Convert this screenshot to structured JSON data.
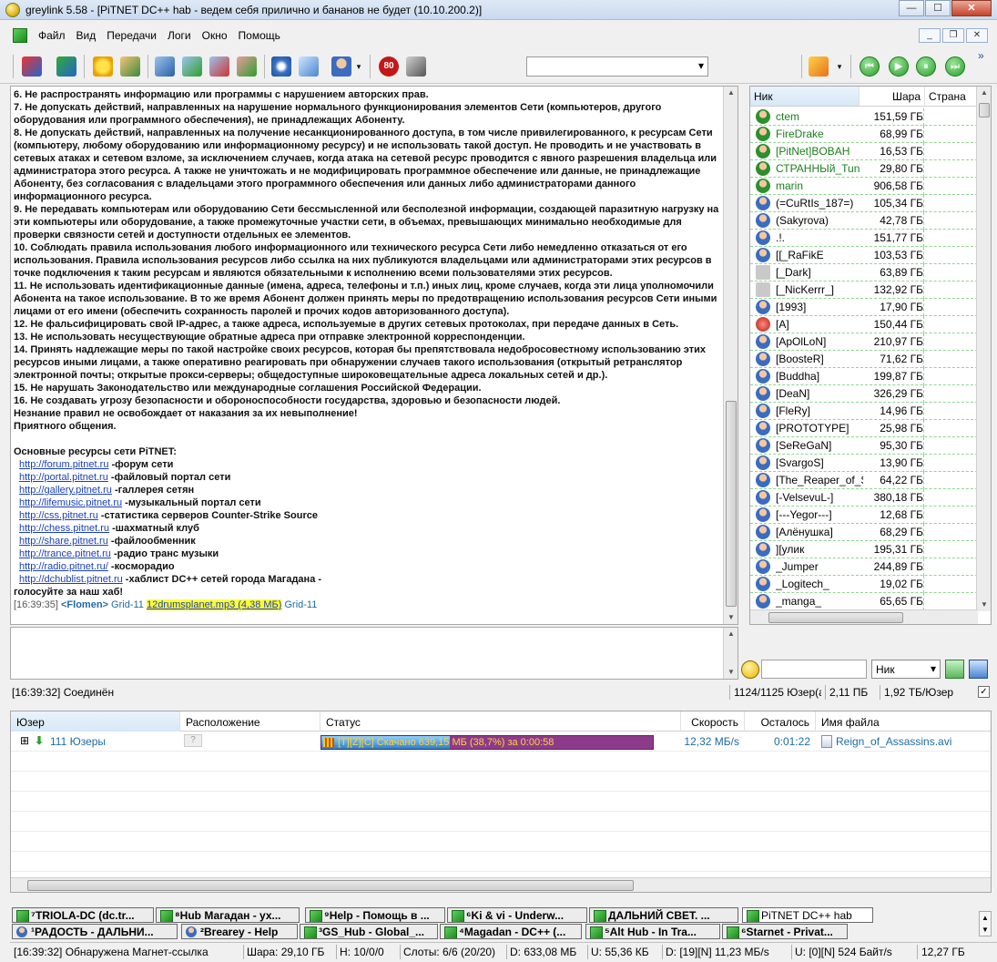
{
  "window": {
    "title": "greylink 5.58 - [PiTNET DC++ hab - ведем себя прилично и бананов не будет (10.10.200.2)]",
    "btn_min": "—",
    "btn_max": "☐",
    "btn_close": "✕"
  },
  "menu": {
    "items": [
      "Файл",
      "Вид",
      "Передачи",
      "Логи",
      "Окно",
      "Помощь"
    ]
  },
  "toolbar": {
    "speed_limit_label": "80",
    "more": "»"
  },
  "chat": {
    "lines": [
      "6. Не распространять информацию или программы с нарушением авторских прав.",
      "7. Не допускать действий, направленных на нарушение нормального функционирования элементов Сети (компьютеров, другого оборудования или программного обеспечения), не принадлежащих Абоненту.",
      "8. Не допускать действий, направленных на получение несанкционированного доступа, в том числе привилегированного, к ресурсам Сети (компьютеру, любому оборудованию или информационному ресурсу) и не использовать такой доступ. Не проводить и не участвовать в сетевых атаках и сетевом взломе, за исключением случаев, когда атака на сетевой ресурс проводится с явного разрешения владельца или администратора этого ресурса. А также не уничтожать и не модифицировать программное обеспечение или данные, не принадлежащие Абоненту, без согласования с владельцами этого программного обеспечения или данных либо администраторами данного информационного ресурса.",
      "9. Не передавать компьютерам или оборудованию Сети бессмысленной или бесполезной информации, создающей паразитную нагрузку на эти компьютеры или оборудование, а также промежуточные участки сети, в объемах, превышающих минимально необходимые для проверки связности сетей и доступности отдельных ее элементов.",
      "10. Соблюдать правила использования любого информационного или технического ресурса Сети либо немедленно отказаться от его использования. Правила использования ресурсов либо ссылка на них публикуются владельцами или администраторами этих ресурсов в точке подключения к таким ресурсам и являются обязательными к исполнению всеми пользователями этих ресурсов.",
      "11. Не использовать идентификационные данные (имена, адреса, телефоны и т.п.) иных лиц, кроме случаев, когда эти лица уполномочили Абонента на такое использование. В то же время Абонент должен принять меры по предотвращению использования ресурсов Сети иными лицами от его имени (обеспечить сохранность паролей и прочих кодов авторизованного доступа).",
      "12. Не фальсифицировать свой IP-адрес, а также адреса, используемые в других сетевых протоколах, при передаче данных в Сеть.",
      "13. Не использовать несуществующие обратные адреса при отправке электронной корреспонденции.",
      "14. Принять надлежащие меры по такой настройке своих ресурсов, которая бы препятствовала недобросовестному использованию этих ресурсов иными лицами, а также оперативно реагировать при обнаружении случаев такого использования (открытый ретранслятор электронной почты; открытые прокси-серверы; общедоступные широковещательные адреса локальных сетей и др.).",
      "15. Не нарушать Законодательство или международные соглашения Российской Федерации.",
      "16. Не создавать угрозу безопасности и обороноспособности государства, здоровью и безопасности людей.",
      "Незнание правил не освобождает от наказания за их невыполнение!",
      "Приятного общения.",
      "",
      "Основные ресурсы сети PiTNET:"
    ],
    "resources": [
      {
        "url": "http://forum.pitnet.ru",
        "desc": "-форум сети"
      },
      {
        "url": "http://portal.pitnet.ru",
        "desc": "-файловый портал сети"
      },
      {
        "url": "http://gallery.pitnet.ru",
        "desc": "-галлерея сетян"
      },
      {
        "url": "http://lifemusic.pitnet.ru",
        "desc": "-музыкальный портал сети"
      },
      {
        "url": "http://css.pitnet.ru",
        "desc": "-статистика серверов Counter-Strike Source"
      },
      {
        "url": "http://chess.pitnet.ru",
        "desc": "-шахматный клуб"
      },
      {
        "url": "http://share.pitnet.ru",
        "desc": "-файлообменник"
      },
      {
        "url": "http://trance.pitnet.ru",
        "desc": "-радио транс музыки"
      },
      {
        "url": "http://radio.pitnet.ru/",
        "desc": "-косморадио"
      },
      {
        "url": "http://dchublist.pitnet.ru",
        "desc": "-хаблист DC++ сетей города Магадана -"
      }
    ],
    "closing": "голосуйте за наш хаб!",
    "message": {
      "time": "[16:39:35]",
      "nick": "<Flomen>",
      "prefix": "Grid-11",
      "file": "12drumsplanet.mp3 (4,38 МБ)",
      "suffix": "Grid-11"
    }
  },
  "userlist": {
    "headers": {
      "nick": "Ник",
      "share": "Шара",
      "country": "Страна"
    },
    "users": [
      {
        "nick": "ctem",
        "share": "151,59 ГБ",
        "kind": "op"
      },
      {
        "nick": "FireDrake",
        "share": "68,99 ГБ",
        "kind": "op"
      },
      {
        "nick": "[PitNet]BOBAH",
        "share": "16,53 ГБ",
        "kind": "op"
      },
      {
        "nick": "СТРАННЫй_Tun",
        "share": "29,80 ГБ",
        "kind": "op"
      },
      {
        "nick": "marin",
        "share": "906,58 ГБ",
        "kind": "op"
      },
      {
        "nick": "(=CuRtIs_187=)",
        "share": "105,34 ГБ",
        "kind": "user"
      },
      {
        "nick": "(Sakyrova)",
        "share": "42,78 ГБ",
        "kind": "user"
      },
      {
        "nick": ".!.",
        "share": "151,77 ГБ",
        "kind": "user"
      },
      {
        "nick": "[[_RaFikE",
        "share": "103,53 ГБ",
        "kind": "user"
      },
      {
        "nick": "[_Dark]",
        "share": "63,89 ГБ",
        "kind": "gray"
      },
      {
        "nick": "[_NicKerrr_]",
        "share": "132,92 ГБ",
        "kind": "gray"
      },
      {
        "nick": "[1993]",
        "share": "17,90 ГБ",
        "kind": "user"
      },
      {
        "nick": "[A]",
        "share": "150,44 ГБ",
        "kind": "red"
      },
      {
        "nick": "[ApOlLoN]",
        "share": "210,97 ГБ",
        "kind": "user"
      },
      {
        "nick": "[BoosteR]",
        "share": "71,62 ГБ",
        "kind": "user"
      },
      {
        "nick": "[Buddha]",
        "share": "199,87 ГБ",
        "kind": "user"
      },
      {
        "nick": "[DeaN]",
        "share": "326,29 ГБ",
        "kind": "user"
      },
      {
        "nick": "[FleRy]",
        "share": "14,96 ГБ",
        "kind": "user"
      },
      {
        "nick": "[PROTOTYPE]",
        "share": "25,98 ГБ",
        "kind": "user"
      },
      {
        "nick": "[SeReGaN]",
        "share": "95,30 ГБ",
        "kind": "user"
      },
      {
        "nick": "[SvargoS]",
        "share": "13,90 ГБ",
        "kind": "user"
      },
      {
        "nick": "[The_Reaper_of_S",
        "share": "64,22 ГБ",
        "kind": "user"
      },
      {
        "nick": "[-VelsevuL-]",
        "share": "380,18 ГБ",
        "kind": "user"
      },
      {
        "nick": "[---Yegor---]",
        "share": "12,68 ГБ",
        "kind": "user"
      },
      {
        "nick": "[Алёнушка]",
        "share": "68,29 ГБ",
        "kind": "user"
      },
      {
        "nick": "][улик",
        "share": "195,31 ГБ",
        "kind": "user"
      },
      {
        "nick": "_Jumper",
        "share": "244,89 ГБ",
        "kind": "user"
      },
      {
        "nick": "_Logitech_",
        "share": "19,02 ГБ",
        "kind": "user"
      },
      {
        "nick": "_manga_",
        "share": "65,65 ГБ",
        "kind": "user"
      }
    ]
  },
  "filter": {
    "field_label": "Ник"
  },
  "hub_status": {
    "status": "[16:39:32] Соединён",
    "users": "1124/1125 Юзер(а",
    "share": "2,11 ПБ",
    "per_user": "1,92 ТБ/Юзер"
  },
  "transfers": {
    "headers": {
      "user": "Юзер",
      "location": "Расположение",
      "status": "Статус",
      "speed": "Скорость",
      "remaining": "Осталось",
      "filename": "Имя файла"
    },
    "rows": [
      {
        "expand": "⊞",
        "user": "111 Юзеры",
        "location": "?",
        "status": "[T][Z][C] Скачано 639,15 МБ (38,7%) за 0:00:58",
        "progress": 0.387,
        "speed": "12,32 МБ/s",
        "remaining": "0:01:22",
        "filename": "Reign_of_Assassins.avi"
      }
    ]
  },
  "tabs": {
    "row1": [
      {
        "label": "⁷TRIOLA-DC (dc.tr...",
        "active": false
      },
      {
        "label": "⁸Hub Магадан - ух...",
        "active": false
      },
      {
        "label": "⁹Help - Помощь в ...",
        "active": false
      },
      {
        "label": "⁶Ki & vi - Underw...",
        "active": false
      },
      {
        "label": "ДАЛЬНИЙ СВЕТ. ...",
        "active": false
      },
      {
        "label": "PiTNET DC++ hab",
        "active": true
      }
    ],
    "row2": [
      {
        "label": "¹РАДОСТЬ - ДАЛЬНИ...",
        "kind": "user"
      },
      {
        "label": "²Brearey - Help",
        "kind": "user"
      },
      {
        "label": "³GS_Hub - Global_...",
        "kind": "hub"
      },
      {
        "label": "⁴Magadan - DC++ (...",
        "kind": "hub"
      },
      {
        "label": "⁵Alt Hub - In Tra...",
        "kind": "hub"
      },
      {
        "label": "⁶Starnet - Privat...",
        "kind": "hub"
      }
    ]
  },
  "statusbar": {
    "message": "[16:39:32] Обнаружена Магнет-ссылка",
    "share": "Шара: 29,10 ГБ",
    "hubs": "H: 10/0/0",
    "slots": "Слоты: 6/6 (20/20)",
    "downloaded": "D: 633,08 МБ",
    "uploaded": "U: 55,36 КБ",
    "dl_speed": "D: [19][N] 11,23 МБ/s",
    "ul_speed": "U: [0][N] 524 Байт/s",
    "free": "12,27 ГБ"
  }
}
